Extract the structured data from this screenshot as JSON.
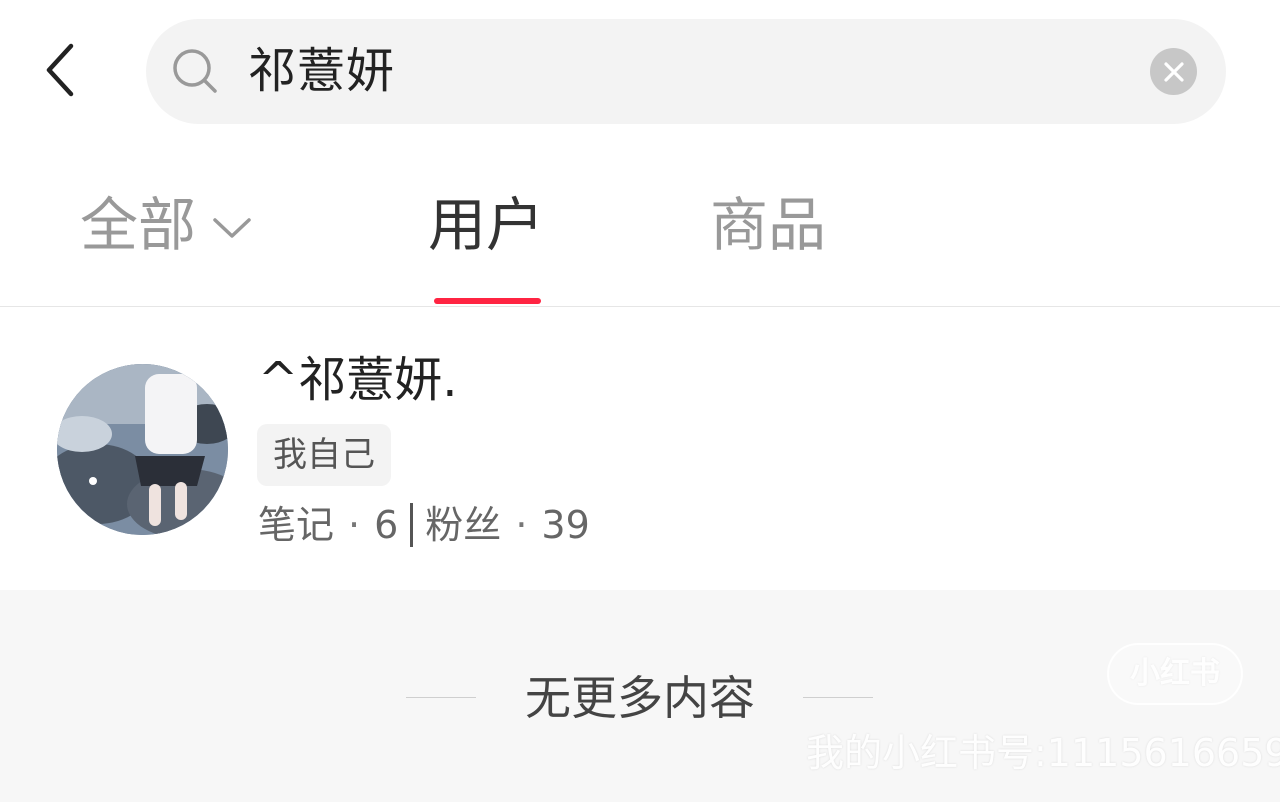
{
  "search": {
    "query": "祁薏妍"
  },
  "tabs": [
    {
      "label": "全部",
      "active": false
    },
    {
      "label": "用户",
      "active": true
    },
    {
      "label": "商品",
      "active": false
    }
  ],
  "user_result": {
    "name": "^祁薏妍.",
    "tag": "我自己",
    "notes_label": "笔记",
    "notes_count": "6",
    "fans_label": "粉丝",
    "fans_count": "39",
    "dot": "·"
  },
  "footer": {
    "no_more": "无更多内容"
  },
  "watermark": {
    "logo": "小红书",
    "account": "我的小红书号:1115616659"
  },
  "colors": {
    "accent": "#ff2442",
    "search_bg": "#f3f3f3",
    "footer_bg": "#f7f7f7"
  }
}
